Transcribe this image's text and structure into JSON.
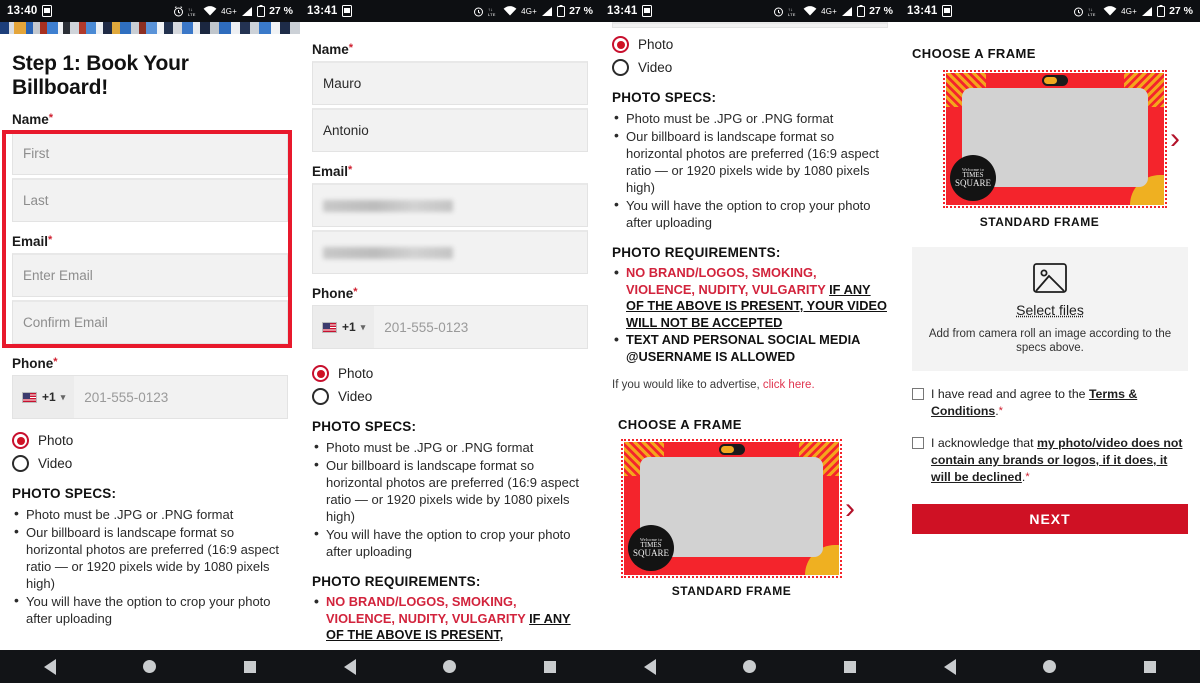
{
  "panels": [
    {
      "statusbar": {
        "time": "13:40",
        "battery": "27 %",
        "net": "4G+",
        "icons": [
          "alarm-icon",
          "mobile-data-icon",
          "wifi-icon",
          "signal-icon",
          "battery-icon"
        ]
      },
      "heading": "Step 1: Book Your Billboard!",
      "name_label": "Name",
      "first_placeholder": "First",
      "last_placeholder": "Last",
      "email_label": "Email",
      "email_placeholder": "Enter Email",
      "confirm_email_placeholder": "Confirm Email",
      "phone_label": "Phone",
      "phone_cc": "+1",
      "phone_placeholder": "201-555-0123",
      "radio_photo": "Photo",
      "radio_video": "Video",
      "specs_title": "PHOTO SPECS:",
      "specs": [
        "Photo must be .JPG or .PNG format",
        "Our billboard is landscape format so horizontal photos are preferred (16:9 aspect ratio — or 1920 pixels wide by 1080 pixels high)",
        "You will have the option to crop your photo after uploading"
      ]
    },
    {
      "statusbar": {
        "time": "13:41",
        "battery": "27 %",
        "net": "4G+"
      },
      "name_label": "Name",
      "first_value": "Mauro",
      "last_value": "Antonio",
      "email_label": "Email",
      "email_value": "",
      "confirm_email_value": "",
      "phone_label": "Phone",
      "phone_cc": "+1",
      "phone_placeholder": "201-555-0123",
      "radio_photo": "Photo",
      "radio_video": "Video",
      "specs_title": "PHOTO SPECS:",
      "specs": [
        "Photo must be .JPG or .PNG format",
        "Our billboard is landscape format so horizontal photos are preferred (16:9 aspect ratio — or 1920 pixels wide by 1080 pixels high)",
        "You will have the option to crop your photo after uploading"
      ],
      "reqs_title": "PHOTO REQUIREMENTS:",
      "req_red": "NO BRAND/LOGOS, SMOKING, VIOLENCE, NUDITY, VULGARITY",
      "req_under": "IF ANY OF THE ABOVE IS PRESENT,"
    },
    {
      "statusbar": {
        "time": "13:41",
        "battery": "27 %",
        "net": "4G+"
      },
      "radio_photo": "Photo",
      "radio_video": "Video",
      "specs_title": "PHOTO SPECS:",
      "specs": [
        "Photo must be .JPG or .PNG format",
        "Our billboard is landscape format so horizontal photos are preferred (16:9 aspect ratio — or 1920 pixels wide by 1080 pixels high)",
        "You will have the option to crop your photo after uploading"
      ],
      "reqs_title": "PHOTO REQUIREMENTS:",
      "req_red": "NO BRAND/LOGOS, SMOKING, VIOLENCE, NUDITY, VULGARITY",
      "req_under": "IF ANY OF THE ABOVE IS PRESENT, YOUR VIDEO WILL NOT BE ACCEPTED",
      "req_two": "TEXT AND PERSONAL SOCIAL MEDIA @USERNAME IS ALLOWED",
      "advert_text": "If you would like to advertise,",
      "advert_link": "click here.",
      "frame_title": "CHOOSE A FRAME",
      "frame_caption": "STANDARD FRAME",
      "frame_next_icon": "chevron-right-icon",
      "frame_badge": [
        "Welcome to",
        "TIMES",
        "SQUARE"
      ]
    },
    {
      "statusbar": {
        "time": "13:41",
        "battery": "27 %",
        "net": "4G+"
      },
      "frame_title": "CHOOSE A FRAME",
      "frame_caption": "STANDARD FRAME",
      "frame_next_icon": "chevron-right-icon",
      "frame_badge": [
        "Welcome to",
        "TIMES",
        "SQUARE"
      ],
      "dropzone_icon": "image-placeholder-icon",
      "dropzone_link": "Select files",
      "dropzone_note": "Add from camera roll an image according to the specs above.",
      "cb1_pre": "I have read and agree to the ",
      "cb1_bold": "Terms & Conditions",
      "cb1_post": ".",
      "cb2_pre": "I acknowledge that ",
      "cb2_bold": "my photo/video does not contain any brands or logos, if it does, it will be declined",
      "cb2_post": ".",
      "next_button": "NEXT"
    }
  ],
  "colors": {
    "accent": "#cf1124",
    "highlight": "#e8192c",
    "frame_red": "#f4242c",
    "link": "#e0354f"
  }
}
